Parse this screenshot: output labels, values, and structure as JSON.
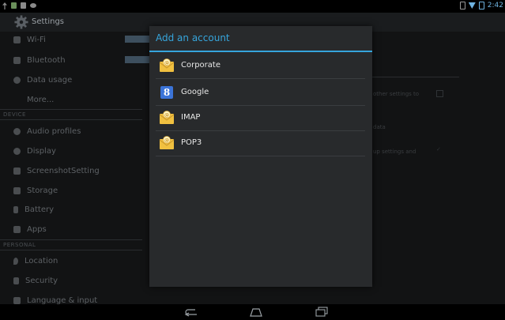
{
  "status_bar": {
    "time": "2:42"
  },
  "action_bar": {
    "title": "Settings",
    "icon": "gear-icon"
  },
  "settings": {
    "items": [
      {
        "label": "Wi-Fi",
        "icon": "wifi-icon"
      },
      {
        "label": "Bluetooth",
        "icon": "bluetooth-icon"
      },
      {
        "label": "Data usage",
        "icon": "data-usage-icon"
      },
      {
        "label": "More...",
        "icon": ""
      }
    ],
    "device_header": "DEVICE",
    "device_items": [
      {
        "label": "Audio profiles",
        "icon": "audio-icon"
      },
      {
        "label": "Display",
        "icon": "display-icon"
      },
      {
        "label": "ScreenshotSetting",
        "icon": "camera-icon"
      },
      {
        "label": "Storage",
        "icon": "storage-icon"
      },
      {
        "label": "Battery",
        "icon": "battery-icon"
      },
      {
        "label": "Apps",
        "icon": "apps-icon"
      }
    ],
    "personal_header": "PERSONAL",
    "personal_items": [
      {
        "label": "Location",
        "icon": "location-icon"
      },
      {
        "label": "Security",
        "icon": "lock-icon"
      },
      {
        "label": "Language & input",
        "icon": "keyboard-icon"
      }
    ],
    "right_hints": [
      "other settings to",
      "data",
      "up settings and"
    ]
  },
  "dialog": {
    "title": "Add an account",
    "accounts": [
      {
        "label": "Corporate",
        "icon": "email-envelope-icon"
      },
      {
        "label": "Google",
        "icon": "google-icon"
      },
      {
        "label": "IMAP",
        "icon": "email-envelope-icon"
      },
      {
        "label": "POP3",
        "icon": "email-envelope-icon"
      }
    ]
  },
  "colors": {
    "accent": "#36a5dc",
    "dialog_bg": "#282a2c",
    "envelope": "#f0c040"
  }
}
